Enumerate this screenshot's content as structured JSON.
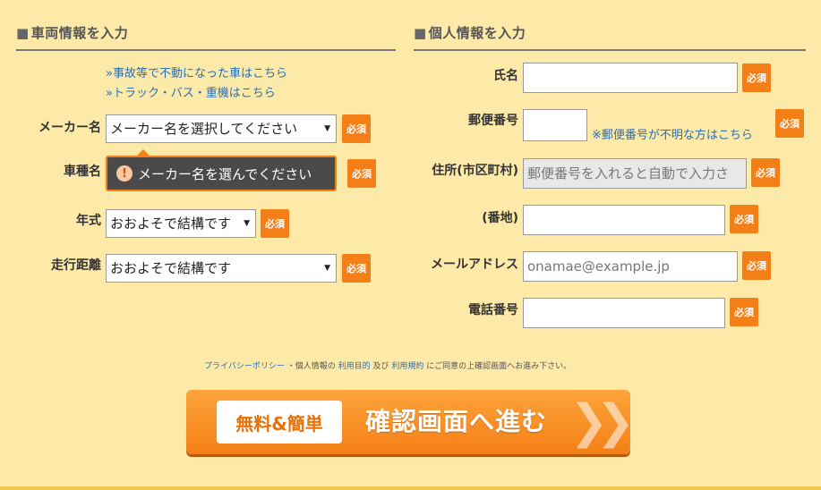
{
  "vehicle": {
    "title": "車両情報を入力",
    "links": [
      "»事故等で不動になった車はこちら",
      "»トラック・バス・重機はこちら"
    ],
    "maker_label": "メーカー名",
    "maker_value": "メーカー名を選択してください",
    "model_label": "車種名",
    "model_tooltip": "メーカー名を選んでください",
    "year_label": "年式",
    "year_value": "おおよそで結構です",
    "mileage_label": "走行距離",
    "mileage_value": "おおよそで結構です"
  },
  "personal": {
    "title": "個人情報を入力",
    "name_label": "氏名",
    "zip_label": "郵便番号",
    "zip_note": "※郵便番号が不明な方はこちら",
    "address_label": "住所(市区町村)",
    "address_placeholder": "郵便番号を入れると自動で入力さ",
    "banchi_label": "(番地)",
    "email_label": "メールアドレス",
    "email_placeholder": "onamae@example.jp",
    "phone_label": "電話番号"
  },
  "required_label": "必須",
  "section_marker": "■",
  "warn_symbol": "!",
  "select_arrow": "▼",
  "privacy": {
    "link1": "プライバシーポリシー",
    "text1": "・個人情報の",
    "link2": "利用目的",
    "text2": "及び",
    "link3": "利用規約",
    "text3": "にご同意の上確認画面へお進み下さい。"
  },
  "cta": {
    "badge": "無料&簡単",
    "label": "確認画面へ進む",
    "chevrons": "❯❯❯"
  },
  "colors": {
    "background": "#fde9a8",
    "accent": "#f57f17",
    "link": "#2a6fb5"
  }
}
